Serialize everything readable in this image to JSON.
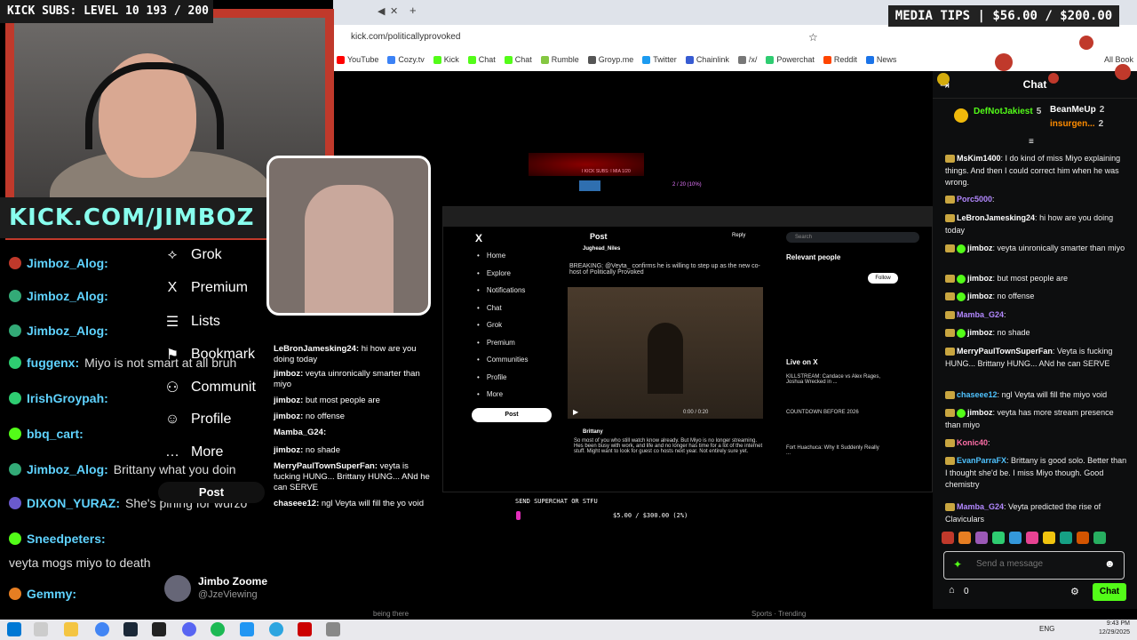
{
  "overlays": {
    "kick_subs": "KICK SUBS: LEVEL 10 193 / 200",
    "media_tips": "MEDIA TIPS | $56.00 / $200.00",
    "kick_banner": "KICK.COM/JIMBOZ",
    "supertext": "SEND SUPERCHAT OR STFU",
    "super_money": "$5.00 / $300.00 (2%)",
    "inner_hud_left": "I KICK SUBS: I MIA 1/20",
    "inner_hud_right": "2 / 20 (10%)"
  },
  "browser": {
    "url": "kick.com/politicallyprovoked",
    "bookmarks": [
      {
        "label": "YouTube",
        "color": "#ff0000"
      },
      {
        "label": "Cozy.tv",
        "color": "#3b82f6"
      },
      {
        "label": "Kick",
        "color": "#53fc18"
      },
      {
        "label": "Chat",
        "color": "#53fc18"
      },
      {
        "label": "Chat",
        "color": "#53fc18"
      },
      {
        "label": "Rumble",
        "color": "#85c742"
      },
      {
        "label": "Groyp.me",
        "color": "#555"
      },
      {
        "label": "Twitter",
        "color": "#1d9bf0"
      },
      {
        "label": "Chainlink",
        "color": "#375bd2"
      },
      {
        "label": "/x/",
        "color": "#777"
      },
      {
        "label": "Powerchat",
        "color": "#2ecc71"
      },
      {
        "label": "Reddit",
        "color": "#ff4500"
      },
      {
        "label": "News",
        "color": "#1a73e8"
      }
    ],
    "all_bookmarks": "All Book"
  },
  "left_chat": [
    {
      "user": "Jimboz_Alog:",
      "msg": ""
    },
    {
      "user": "Jimboz_Alog:",
      "msg": ""
    },
    {
      "user": "Jimboz_Alog:",
      "msg": ""
    },
    {
      "user": "fuggenx:",
      "msg": "Miyo is not smart at all bruh"
    },
    {
      "user": "IrishGroypah:",
      "msg": ""
    },
    {
      "user": "bbq_cart:",
      "msg": ""
    },
    {
      "user": "Jimboz_Alog:",
      "msg": "Brittany what you doin"
    },
    {
      "user": "DIXON_YURAZ:",
      "msg": "She's pining for wurzo"
    },
    {
      "user": "Sneedpeters:",
      "msg": ""
    },
    {
      "user": "",
      "msg": "veyta mogs miyo to death"
    },
    {
      "user": "Gemmy:",
      "msg": ""
    }
  ],
  "x_sidebar": {
    "items": [
      {
        "icon": "⟡",
        "label": "Grok"
      },
      {
        "icon": "X",
        "label": "Premium"
      },
      {
        "icon": "☰",
        "label": "Lists"
      },
      {
        "icon": "⚑",
        "label": "Bookmark"
      },
      {
        "icon": "⚇",
        "label": "Communit"
      },
      {
        "icon": "☺",
        "label": "Profile"
      },
      {
        "icon": "…",
        "label": "More"
      }
    ],
    "post": "Post",
    "user_name": "Jimbo Zoome",
    "user_handle": "@JzeViewing"
  },
  "inner_screen": {
    "nav": [
      "Home",
      "Explore",
      "Notifications",
      "Chat",
      "Grok",
      "Premium",
      "Communities",
      "Profile",
      "More"
    ],
    "post": "Post",
    "header": "Post",
    "reply": "Reply",
    "tweet_author": "Jughead_Niles",
    "tweet_text": "BREAKING: @Veyta_ confirms he is willing to step up as the new co-host of Politically Provoked",
    "relevant": "Relevant people",
    "follow": "Follow",
    "live": "Live on X",
    "live_items": [
      "KILLSTREAM: Candace vs Alex Rages, Joshua Wrecked in ...",
      "COUNTDOWN BEFORE 2026",
      "Fort Huachuca: Why It Suddenly Really ..."
    ],
    "reply_author": "Brittany",
    "reply_text": "So most of you who still watch know already. But Miyo is no longer streaming. Hes been busy with work, and life and no longer has time for a lot of the internet stuff. Might want to look for guest co hosts next year. Not entirely sure yet.",
    "video_time": "0:00 / 0:20",
    "search": "Search"
  },
  "mid_chat": [
    {
      "user": "LeBronJamesking24:",
      "msg": "hi how are you doing today"
    },
    {
      "user": "jimboz:",
      "msg": "veyta uinronically smarter than miyo"
    },
    {
      "user": "jimboz:",
      "msg": "but most people are"
    },
    {
      "user": "jimboz:",
      "msg": "no offense"
    },
    {
      "user": "Mamba_G24:",
      "msg": ""
    },
    {
      "user": "jimboz:",
      "msg": "no shade"
    },
    {
      "user": "MerryPaulTownSuperFan:",
      "msg": "veyta is fucking HUNG... Brittany HUNG... ANd he can SERVE"
    },
    {
      "user": "chaseee12:",
      "msg": "ngl Veyta will fill the yo void"
    }
  ],
  "kick_chat": {
    "title": "Chat",
    "pinned": [
      {
        "user": "DefNotJakiest",
        "count": "5"
      },
      {
        "user": "BeanMeUp",
        "count": "2"
      },
      {
        "user": "insurgen...",
        "count": "2"
      }
    ],
    "messages": [
      {
        "user": "MsKim1400",
        "color": "#ffffff",
        "text": "I do kind of miss Miyo explaining things. And then I could correct him when he was wrong."
      },
      {
        "user": "Porc5000",
        "color": "#b288ff",
        "text": ""
      },
      {
        "user": "LeBronJamesking24",
        "color": "#ffffff",
        "text": "hi how are you doing today"
      },
      {
        "user": "jimboz",
        "color": "#ffffff",
        "text": "veyta uinronically smarter than miyo"
      },
      {
        "user": "jimboz",
        "color": "#ffffff",
        "text": "but most people are"
      },
      {
        "user": "jimboz",
        "color": "#ffffff",
        "text": "no offense"
      },
      {
        "user": "Mamba_G24",
        "color": "#b288ff",
        "text": ""
      },
      {
        "user": "jimboz",
        "color": "#ffffff",
        "text": "no shade"
      },
      {
        "user": "MerryPaulTownSuperFan",
        "color": "#ffffff",
        "text": "Veyta is fucking HUNG... Brittany HUNG... ANd he can SERVE"
      },
      {
        "user": "chaseee12",
        "color": "#4fc3ff",
        "text": "ngl Veyta will fill the miyo void"
      },
      {
        "user": "jimboz",
        "color": "#ffffff",
        "text": "veyta has more stream presence than miyo"
      },
      {
        "user": "Konic40",
        "color": "#ff6fa8",
        "text": ""
      },
      {
        "user": "EvanParraFX",
        "color": "#4fc3ff",
        "text": "Brittany is good solo. Better than I thought she'd be. I miss Miyo though. Good chemistry"
      },
      {
        "user": "Mamba_G24",
        "color": "#b288ff",
        "text": "Veyta predicted the rise of Claviculars"
      }
    ],
    "placeholder": "Send a message",
    "send": "Chat",
    "points": "0"
  },
  "below": {
    "left": "being there",
    "right": "Sports · Trending"
  },
  "taskbar": {
    "lang": "ENG",
    "time": "9:43 PM",
    "date": "12/29/2025"
  }
}
